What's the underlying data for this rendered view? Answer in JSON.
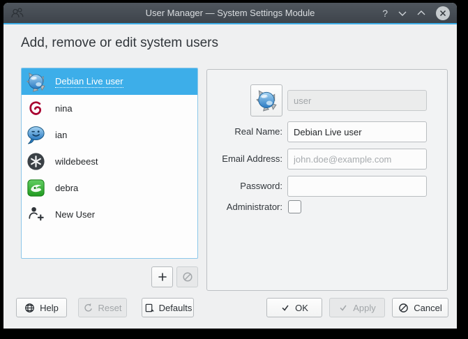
{
  "titlebar": {
    "title": "User Manager — System Settings Module",
    "help_glyph": "?"
  },
  "heading": "Add, remove or edit system users",
  "user_list": {
    "items": [
      {
        "name": "Debian Live user",
        "icon": "kde-globe-avatar",
        "selected": true
      },
      {
        "name": "nina",
        "icon": "debian-swirl"
      },
      {
        "name": "ian",
        "icon": "blue-speech-bubble"
      },
      {
        "name": "wildebeest",
        "icon": "dark-asterisk"
      },
      {
        "name": "debra",
        "icon": "green-swirl-square"
      },
      {
        "name": "New User",
        "icon": "add-user-outline"
      }
    ]
  },
  "list_toolbar": {
    "add_icon": "plus",
    "remove_icon": "no-entry",
    "remove_disabled": true
  },
  "details_form": {
    "avatar_icon": "kde-globe-avatar",
    "username": {
      "value": "user",
      "disabled": true
    },
    "real_name": {
      "label": "Real Name:",
      "value": "Debian Live user"
    },
    "email": {
      "label": "Email Address:",
      "placeholder": "john.doe@example.com",
      "value": ""
    },
    "password": {
      "label": "Password:",
      "value": ""
    },
    "administrator": {
      "label": "Administrator:",
      "checked": false
    }
  },
  "footer": {
    "help": "Help",
    "reset": "Reset",
    "defaults": "Defaults",
    "ok": "OK",
    "apply": "Apply",
    "cancel": "Cancel",
    "reset_disabled": true,
    "apply_disabled": true
  },
  "colors": {
    "accent": "#3daee9",
    "titlebar_bg": "#474e56",
    "window_bg": "#eff0f1",
    "groupbox_bg": "#f2f3f4",
    "view_bg": "#fdfdfd",
    "selection_bg": "#3daee9",
    "text": "#31363b",
    "disabled_text": "#a2a6a9",
    "debian_red": "#a80030",
    "debra_green": "#27a327"
  }
}
